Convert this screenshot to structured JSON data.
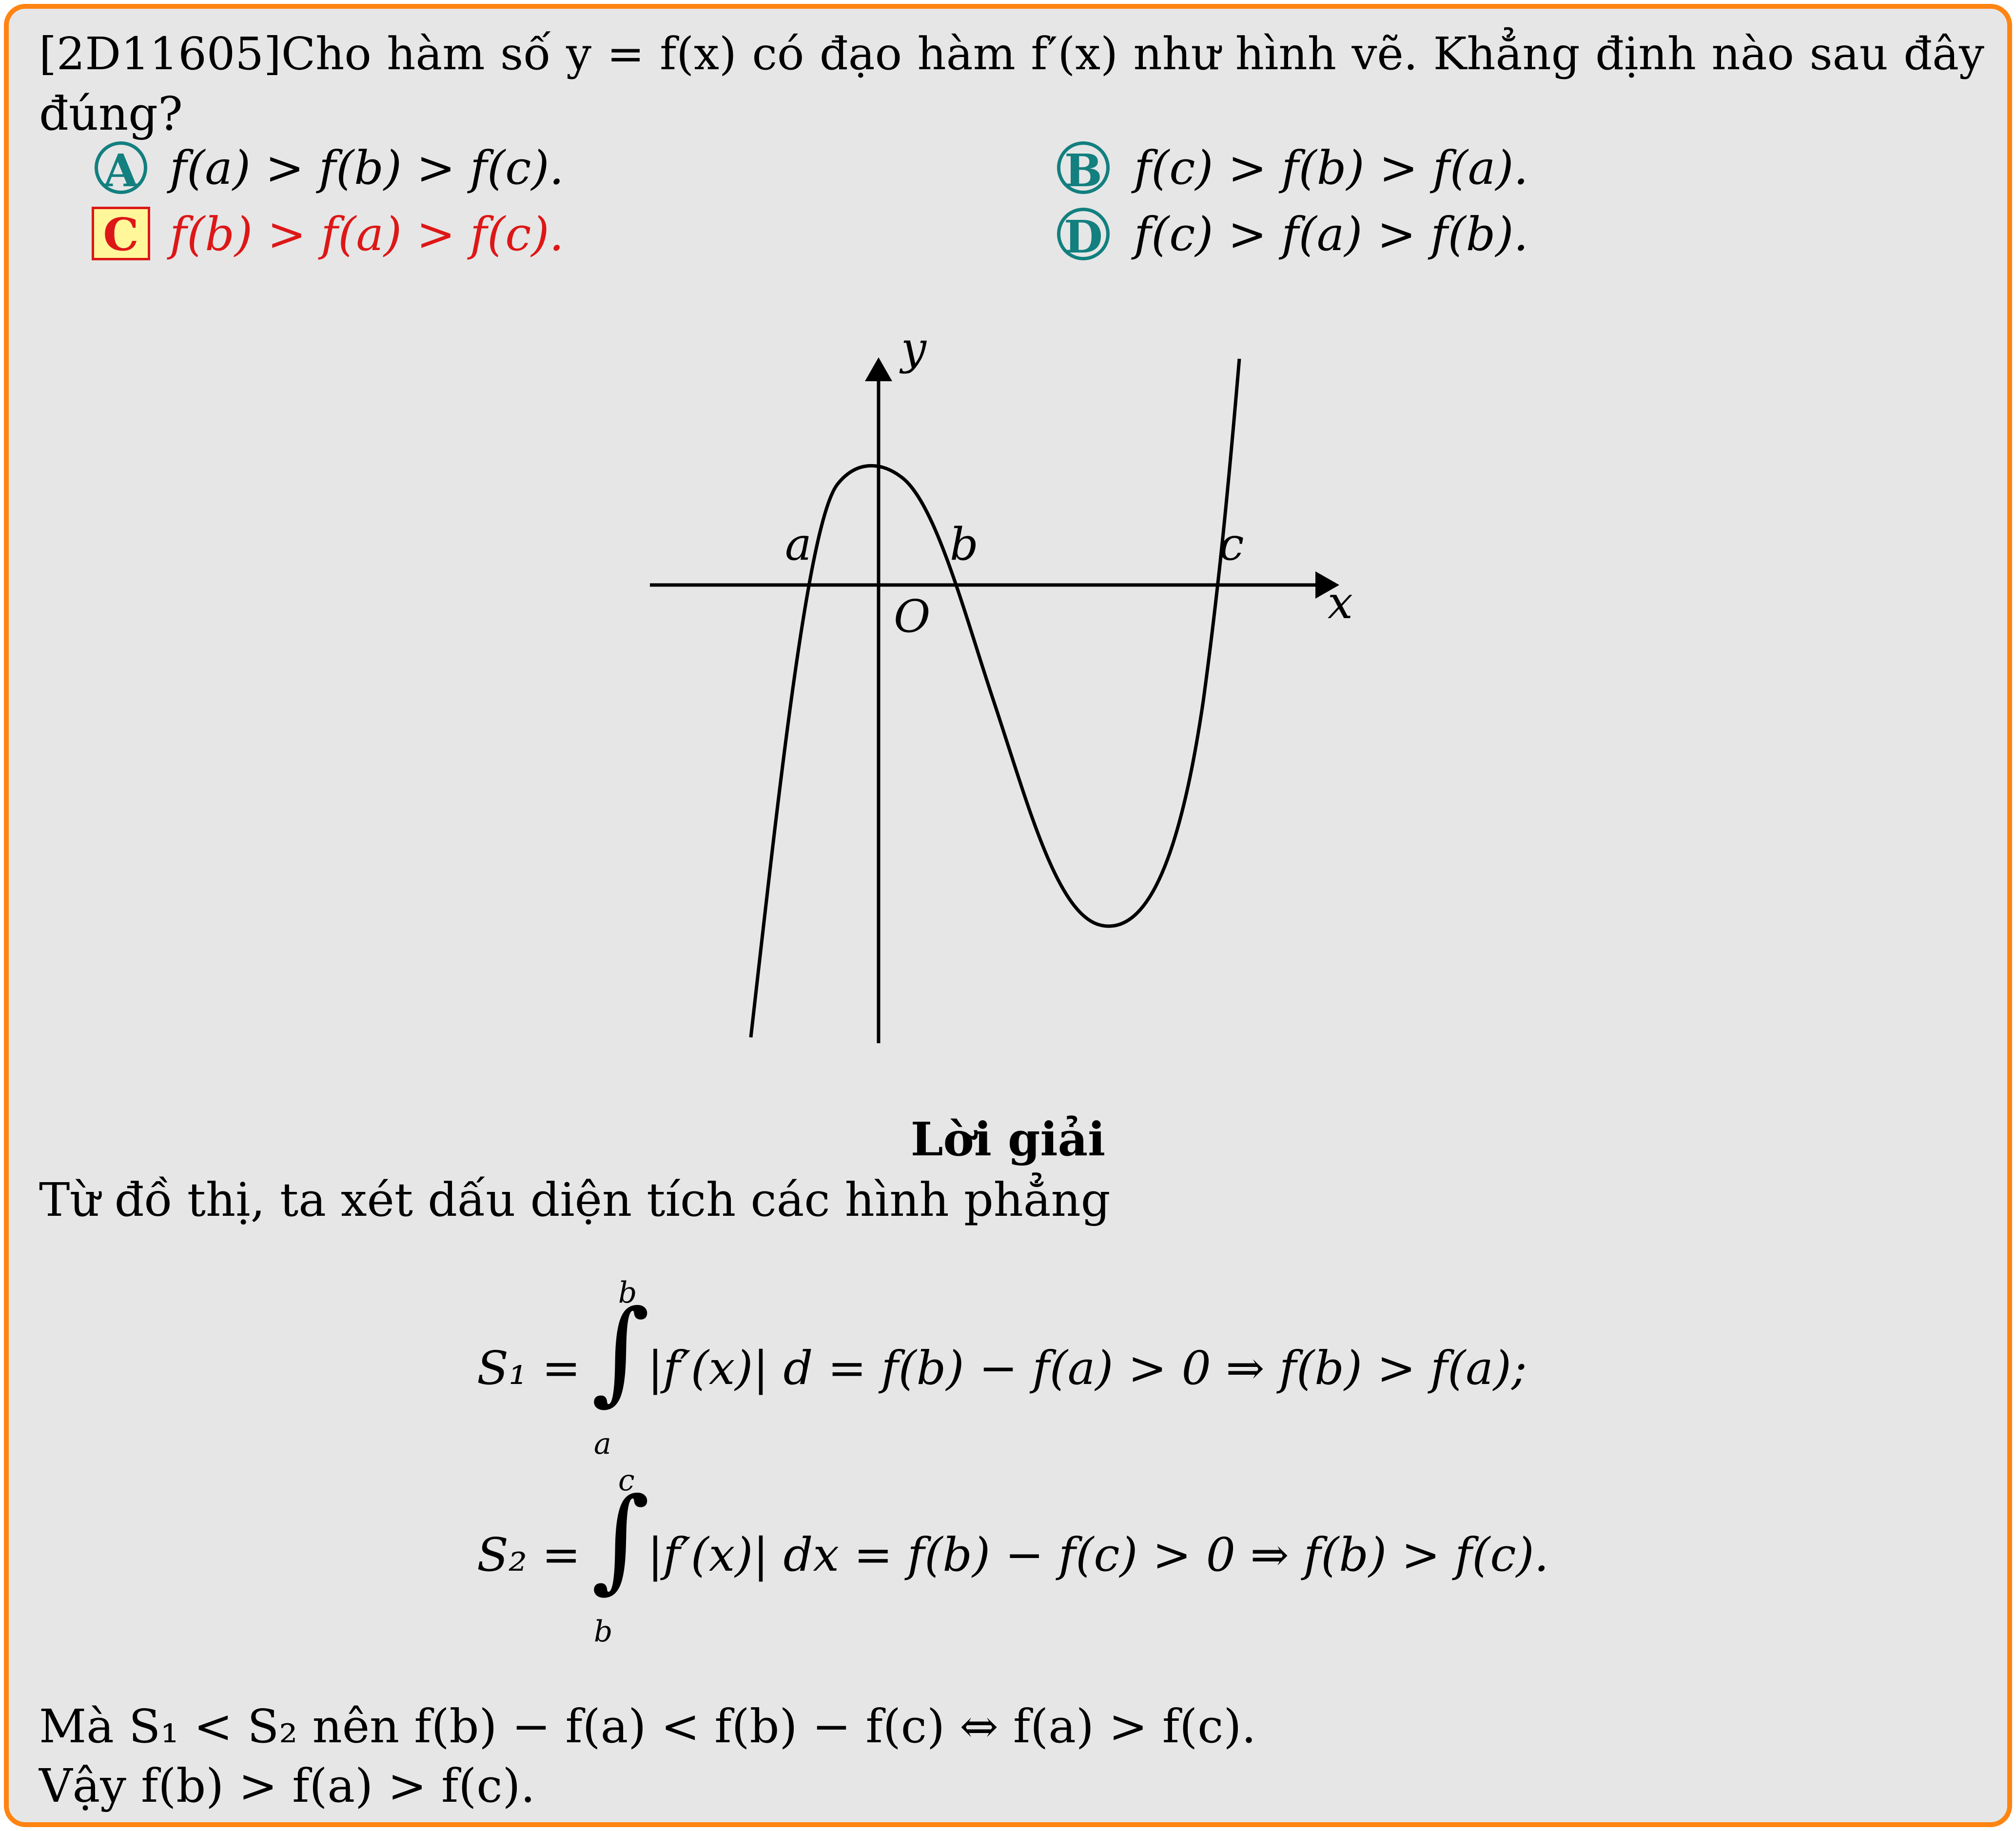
{
  "question": {
    "line1": "[2D11605]Cho hàm số y = f(x) có đạo hàm f′(x) như hình vẽ. Khẳng định nào sau đây",
    "line2": "đúng?"
  },
  "options": [
    {
      "letter": "A",
      "text": "f(a) > f(b) > f(c).",
      "correct": false
    },
    {
      "letter": "B",
      "text": "f(c) > f(b) > f(a).",
      "correct": false
    },
    {
      "letter": "C",
      "text": "f(b) > f(a) > f(c).",
      "correct": true
    },
    {
      "letter": "D",
      "text": "f(c) > f(a) > f(b).",
      "correct": false
    }
  ],
  "graph": {
    "y_label": "y",
    "x_label": "x",
    "origin_label": "O",
    "root_labels": [
      "a",
      "b",
      "c"
    ]
  },
  "solution": {
    "heading": "Lời giải",
    "intro": "Từ đồ thị, ta xét dấu diện tích các hình phẳng",
    "eq1": {
      "lhs": "S₁ =",
      "upper": "b",
      "lower": "a",
      "rhs": "|f′(x)| d = f(b) − f(a) > 0 ⇒ f(b) > f(a);"
    },
    "eq2": {
      "lhs": "S₂ =",
      "upper": "c",
      "lower": "b",
      "rhs": "|f′(x)| dx = f(b) − f(c) > 0 ⇒ f(b) > f(c)."
    },
    "line3": "Mà S₁ < S₂ nên f(b) − f(a) < f(b) − f(c) ⇔ f(a) > f(c).",
    "line4": "Vậy f(b) > f(a) > f(c)."
  },
  "colors": {
    "border": "#ff8411",
    "background": "#e6e6e6",
    "option_teal": "#137f7f",
    "answer_red": "#dd1717",
    "answer_fill": "#fff79a"
  }
}
